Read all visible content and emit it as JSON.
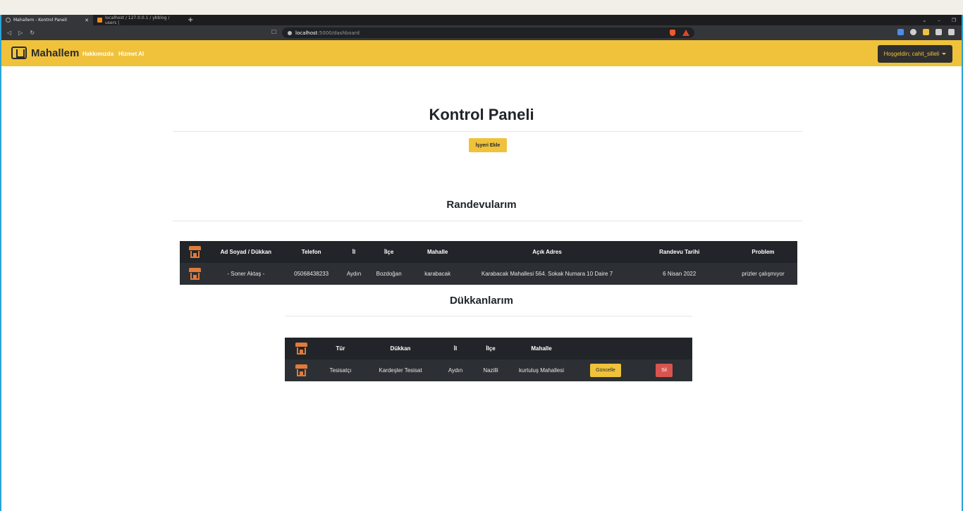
{
  "browser": {
    "tabs": [
      {
        "label": "Mahallem - Kontrol Paneli",
        "active": true
      },
      {
        "label": "localhost / 127.0.0.1 / ybblog / users |",
        "active": false
      }
    ],
    "url_host": "localhost",
    "url_path": ":5000/dashboard"
  },
  "navbar": {
    "brand": "Mahallem",
    "links": [
      "Hakkımızda",
      "Hizmet Al"
    ],
    "user_label": "Hoşgeldin; cahit_silleli"
  },
  "page": {
    "title": "Kontrol Paneli",
    "add_button": "İşyeri Ekle"
  },
  "appointments": {
    "title": "Randevularım",
    "headers": [
      "Ad Soyad / Dükkan",
      "Telefon",
      "İl",
      "İlçe",
      "Mahalle",
      "Açık Adres",
      "Randevu Tarihi",
      "Problem"
    ],
    "rows": [
      [
        "- Soner Aktaş -",
        "05068438233",
        "Aydın",
        "Bozdoğan",
        "karabacak",
        "Karabacak Mahallesi 564. Sokak Numara 10 Daire 7",
        "6 Nisan 2022",
        "prizler çalışmıyor"
      ]
    ]
  },
  "shops": {
    "title": "Dükkanlarım",
    "headers": [
      "Tür",
      "Dükkan",
      "İl",
      "İlçe",
      "Mahalle"
    ],
    "rows": [
      [
        "Tesisatçı",
        "Kardeşler Tesisat",
        "Aydın",
        "Nazilli",
        "kurtuluş Mahallesi"
      ]
    ],
    "update_label": "Güncelle",
    "delete_label": "Sil"
  },
  "colors": {
    "navbar": "#f0c23b",
    "table_dark": "#2c3034",
    "icon_orange": "#e07b3a",
    "danger": "#d9534f"
  }
}
